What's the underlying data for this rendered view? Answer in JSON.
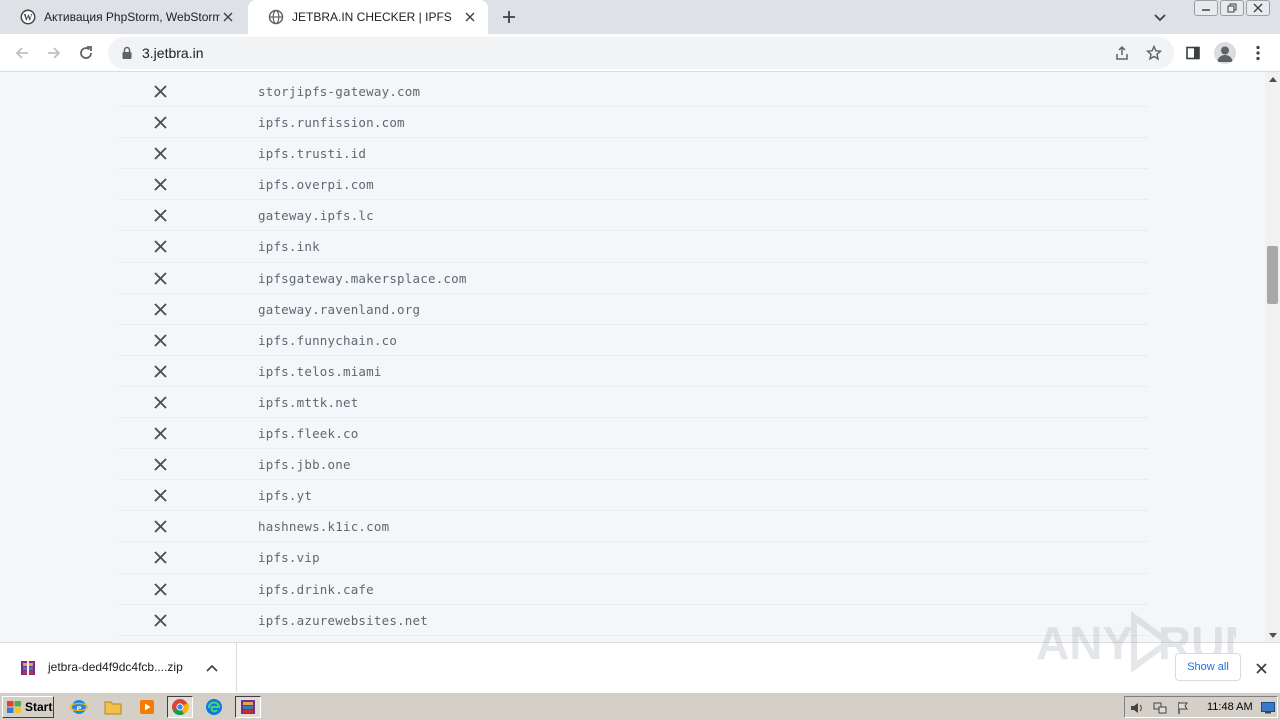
{
  "browser": {
    "tabs": [
      {
        "title": "Активация PhpStorm, WebStorm, In",
        "active": false,
        "favicon": "wordpress-icon"
      },
      {
        "title": "JETBRA.IN CHECKER | IPFS",
        "active": true,
        "favicon": "globe-icon"
      }
    ],
    "url": "3.jetbra.in"
  },
  "gateways": [
    {
      "host": "storjipfs-gateway.com",
      "status": "failed"
    },
    {
      "host": "ipfs.runfission.com",
      "status": "failed"
    },
    {
      "host": "ipfs.trusti.id",
      "status": "failed"
    },
    {
      "host": "ipfs.overpi.com",
      "status": "failed"
    },
    {
      "host": "gateway.ipfs.lc",
      "status": "failed"
    },
    {
      "host": "ipfs.ink",
      "status": "failed"
    },
    {
      "host": "ipfsgateway.makersplace.com",
      "status": "failed"
    },
    {
      "host": "gateway.ravenland.org",
      "status": "failed"
    },
    {
      "host": "ipfs.funnychain.co",
      "status": "failed"
    },
    {
      "host": "ipfs.telos.miami",
      "status": "failed"
    },
    {
      "host": "ipfs.mttk.net",
      "status": "failed"
    },
    {
      "host": "ipfs.fleek.co",
      "status": "failed"
    },
    {
      "host": "ipfs.jbb.one",
      "status": "failed"
    },
    {
      "host": "ipfs.yt",
      "status": "failed"
    },
    {
      "host": "hashnews.k1ic.com",
      "status": "failed"
    },
    {
      "host": "ipfs.vip",
      "status": "failed"
    },
    {
      "host": "ipfs.drink.cafe",
      "status": "failed"
    },
    {
      "host": "ipfs.azurewebsites.net",
      "status": "failed"
    }
  ],
  "download_bar": {
    "file_name": "jetbra-ded4f9dc4fcb....zip",
    "show_all_label": "Show all"
  },
  "watermark": {
    "text": "ANY RUN"
  },
  "taskbar": {
    "start_label": "Start",
    "clock": "11:48 AM"
  }
}
